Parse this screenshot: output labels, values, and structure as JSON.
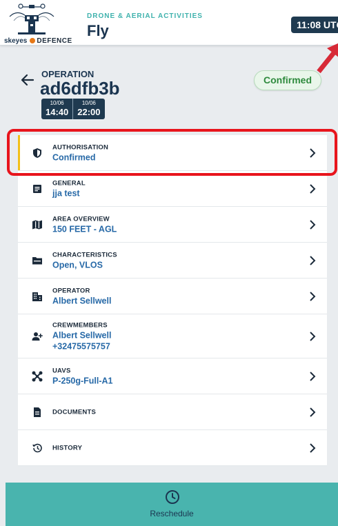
{
  "header": {
    "logo_brand": "skeyes",
    "logo_partner": "DEFENCE",
    "subtitle": "DRONE & AERIAL ACTIVITIES",
    "title": "Fly",
    "clock": "11:08 UTC"
  },
  "operation": {
    "label": "OPERATION",
    "id": "ad6dfb3b",
    "start": {
      "date": "10/06",
      "time": "14:40"
    },
    "end": {
      "date": "10/06",
      "time": "22:00"
    },
    "status": "Confirmed"
  },
  "sections": [
    {
      "label": "AUTHORISATION",
      "value": "Confirmed",
      "icon": "shield-icon"
    },
    {
      "label": "GENERAL",
      "value": "jja test",
      "icon": "document-icon"
    },
    {
      "label": "AREA OVERVIEW",
      "value": "150 FEET - AGL",
      "icon": "map-icon"
    },
    {
      "label": "CHARACTERISTICS",
      "value": "Open, VLOS",
      "icon": "folder-icon"
    },
    {
      "label": "OPERATOR",
      "value": "Albert Sellwell",
      "icon": "building-icon"
    },
    {
      "label": "CREWMEMBERS",
      "value": "Albert Sellwell",
      "value2": "+32475575757",
      "icon": "add-person-icon"
    },
    {
      "label": "UAVS",
      "value": "P-250g-Full-A1",
      "icon": "drone-icon"
    },
    {
      "label": "DOCUMENTS",
      "icon": "file-icon"
    },
    {
      "label": "HISTORY",
      "icon": "history-icon"
    }
  ],
  "footer": {
    "label": "Reschedule",
    "icon": "clock-icon"
  },
  "colors": {
    "accent": "#49b4ae",
    "navy": "#1f3a50",
    "link": "#2769a7",
    "highlight": "#e8141c",
    "success": "#2e8a3d"
  }
}
